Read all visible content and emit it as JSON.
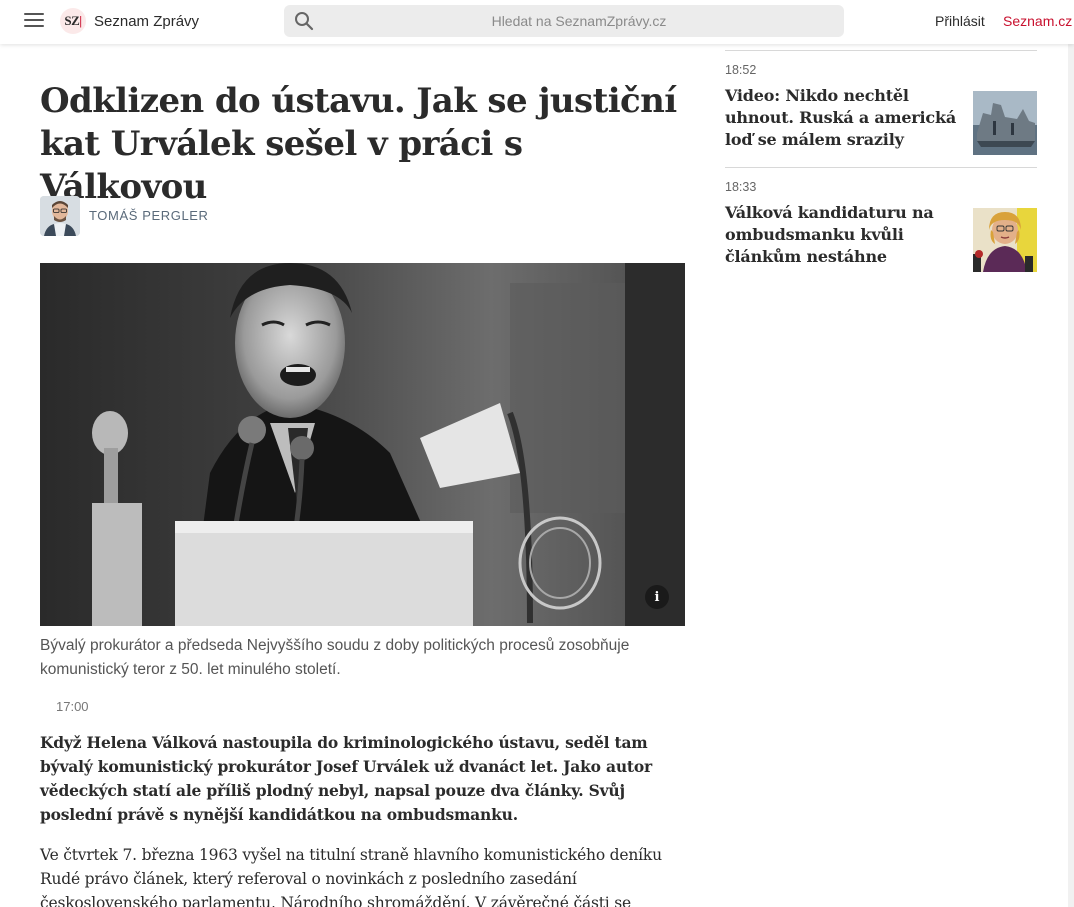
{
  "header": {
    "brand": "Seznam Zprávy",
    "logo_text": "SZ",
    "search_placeholder": "Hledat na SeznamZprávy.cz",
    "login": "Přihlásit",
    "seznam_link": "Seznam.cz"
  },
  "article": {
    "title": "Odklizen do ústavu. Jak se justiční kat Urválek sešel v práci s Válkovou",
    "author": "TOMÁŠ PERGLER",
    "info_icon_label": "i",
    "caption": "Bývalý prokurátor a předseda Nejvyššího soudu z doby politických procesů zosobňuje komunistický teror z 50. let minulého století.",
    "time": "17:00",
    "perex": "Když Helena Válková nastoupila do kriminologického ústavu, seděl tam bývalý komunistický prokurátor Josef Urválek už dvanáct let. Jako autor vědeckých statí ale příliš plodný nebyl, napsal pouze dva články. Svůj poslední právě s nynější kandidátkou na ombudsmanku.",
    "body": "Ve čtvrtek 7. března 1963 vyšel na titulní straně hlavního komunistického deníku Rudé právo článek, který referoval o novinkách z posledního zasedání československého parlamentu, Národního shromáždění. V závěrečné části se"
  },
  "sidebar": {
    "items": [
      {
        "time": "18:52",
        "title": "Video: Nikdo nechtěl uhnout. Ruská a americká loď se málem srazily"
      },
      {
        "time": "18:33",
        "title": "Válková kandidaturu na ombudsmanku kvůli článkům nestáhne"
      }
    ]
  },
  "colors": {
    "accent": "#c8102e",
    "text": "#2b2b2b",
    "muted": "#5a6a7a"
  },
  "icons": [
    "menu-icon",
    "logo-icon",
    "search-icon",
    "info-icon"
  ]
}
